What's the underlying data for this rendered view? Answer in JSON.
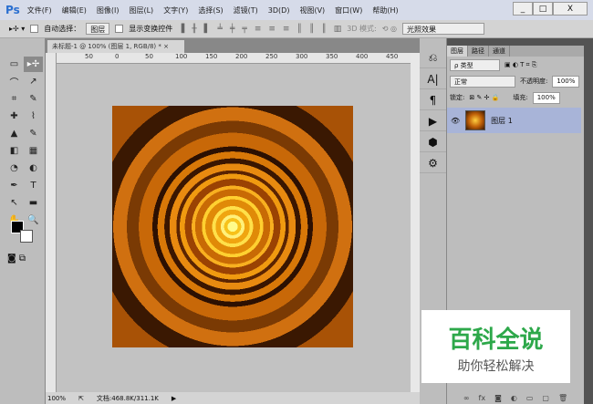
{
  "app": {
    "logo": "Ps",
    "menus": [
      "文件(F)",
      "编辑(E)",
      "图像(I)",
      "图层(L)",
      "文字(Y)",
      "选择(S)",
      "滤镜(T)",
      "3D(D)",
      "视图(V)",
      "窗口(W)",
      "帮助(H)"
    ],
    "window_buttons": [
      "_",
      "□",
      "X"
    ]
  },
  "options": {
    "auto_select_label": "自动选择：",
    "auto_select_value": "图层",
    "show_transform_label": "显示变换控件",
    "mode_3d": "3D 模式:",
    "light_effect": "光照效果"
  },
  "document": {
    "tab_title": "未标题-1 @ 100% (图层 1, RGB/8) *",
    "tab_close": "×",
    "ruler_labels": [
      "50",
      "0",
      "50",
      "100",
      "150",
      "200",
      "250",
      "300",
      "350",
      "400",
      "450"
    ]
  },
  "tools": [
    "▭",
    "▸✢",
    "⌒",
    "↗",
    "⌗",
    "✎",
    "✚",
    "⌇",
    "▲",
    "✎",
    "◧",
    "▦",
    "◔",
    "◐",
    "✒",
    "T",
    "↖",
    "▬",
    "✋",
    "🔍"
  ],
  "status": {
    "zoom": "100%",
    "doc_info": "文档:468.8K/311.1K"
  },
  "layers_panel": {
    "tabs": [
      "图层",
      "路径",
      "通道"
    ],
    "filter": "ρ 类型",
    "blend_mode": "正常",
    "opacity_label": "不透明度:",
    "opacity": "100%",
    "lock_label": "锁定:",
    "fill_label": "填充:",
    "fill": "100%",
    "layers": [
      {
        "name": "图层 1",
        "visible": true,
        "selected": true
      }
    ],
    "footer_icons": [
      "∞",
      "fx",
      "◙",
      "◐",
      "▭",
      "▢",
      "🗑"
    ]
  },
  "watermark": {
    "title": "百科全说",
    "subtitle": "助你轻松解决"
  }
}
